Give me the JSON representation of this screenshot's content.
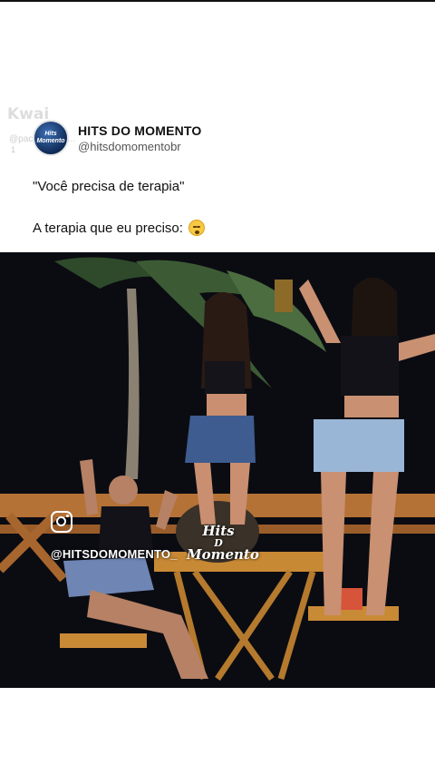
{
  "app": {
    "name": "Kwai"
  },
  "watermark": {
    "brand": "Kwai",
    "handle": "@pacidhareva...",
    "extra": "1"
  },
  "post": {
    "display_name": "HITS DO MOMENTO",
    "handle": "@hitsdomomentobr",
    "line1": "\"Você precisa de terapia\"",
    "line2": "A terapia que eu preciso:",
    "emoji": "face-with-open-mouth-emoji"
  },
  "video_overlay": {
    "instagram_handle": "@HITSDOMOMENTO_",
    "logo_line1": "Hits",
    "logo_line2": "D",
    "logo_line3": "Momento"
  },
  "colors": {
    "background": "#ffffff",
    "video_bg": "#0b0c12",
    "avatar": "#0f2b57"
  }
}
